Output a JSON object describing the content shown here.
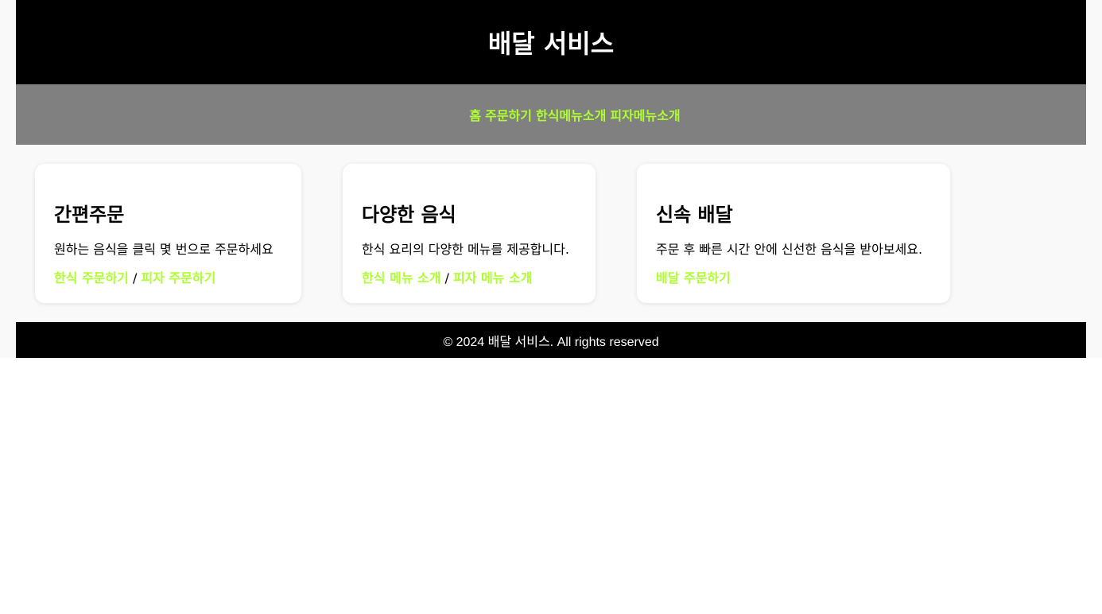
{
  "header": {
    "title": "배달 서비스"
  },
  "nav": {
    "items": [
      {
        "label": "홈"
      },
      {
        "label": "주문하기"
      },
      {
        "label": "한식메뉴소개"
      },
      {
        "label": "피자메뉴소개"
      }
    ]
  },
  "cards": [
    {
      "title": "간편주문",
      "description": "원하는 음식을 클릭 몇 번으로 주문하세요",
      "links": [
        {
          "label": "한식 주문하기"
        },
        {
          "label": "피자 주문하기"
        }
      ],
      "separator": " / "
    },
    {
      "title": "다양한 음식",
      "description": "한식 요리의 다양한 메뉴를 제공합니다.",
      "links": [
        {
          "label": "한식 메뉴 소개"
        },
        {
          "label": "피자 메뉴 소개"
        }
      ],
      "separator": " / "
    },
    {
      "title": "신속 배달",
      "description": "주문 후 빠른 시간 안에 신선한 음식을 받아보세요.",
      "links": [
        {
          "label": "배달 주문하기"
        }
      ]
    }
  ],
  "footer": {
    "text": "© 2024 배달 서비스. All rights reserved"
  },
  "colors": {
    "header_bg": "#000000",
    "nav_bg": "#808080",
    "link": "#adff2f",
    "page_bg": "#f9f9f9"
  }
}
